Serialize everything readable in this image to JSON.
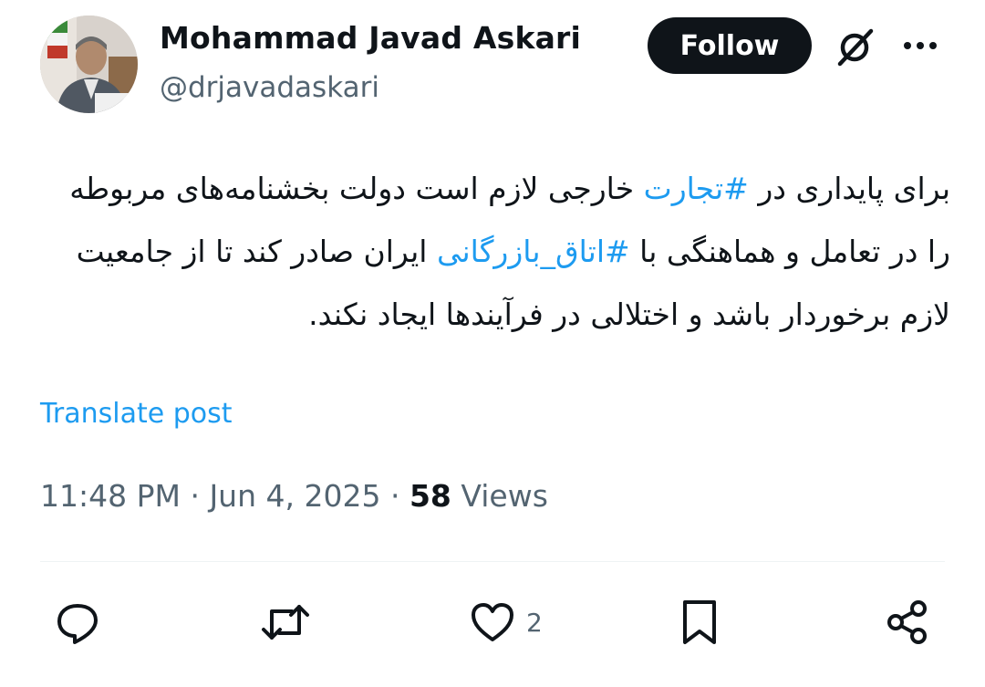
{
  "author": {
    "display_name": "Mohammad Javad Askari",
    "handle": "@drjavadaskari"
  },
  "header": {
    "follow_label": "Follow",
    "grok_icon": "grok-slash-circle-icon",
    "more_icon": "more-dots-icon"
  },
  "tweet": {
    "text_before_tag1": "برای پایداری در ",
    "hashtag1": "#تجارت",
    "text_between": " خارجی لازم است دولت بخشنامه‌های مربوطه را در تعامل و هماهنگی با ",
    "hashtag2": "#اتاق_بازرگانی",
    "text_after_tag2": " ایران صادر کند تا از جامعیت لازم برخوردار باشد و اختلالی در فرآیندها ایجاد نکند."
  },
  "translate_label": "Translate post",
  "meta": {
    "time": "11:48 PM",
    "separator": " · ",
    "date": "Jun 4, 2025",
    "views_count": "58",
    "views_label": " Views"
  },
  "actions": {
    "reply_icon": "reply-bubble-icon",
    "repost_icon": "repost-icon",
    "like_icon": "heart-icon",
    "like_count": "2",
    "bookmark_icon": "bookmark-icon",
    "share_icon": "share-icon"
  },
  "colors": {
    "text": "#0f1419",
    "secondary": "#536471",
    "accent": "#1d9bf0",
    "follow_bg": "#0f1419"
  }
}
